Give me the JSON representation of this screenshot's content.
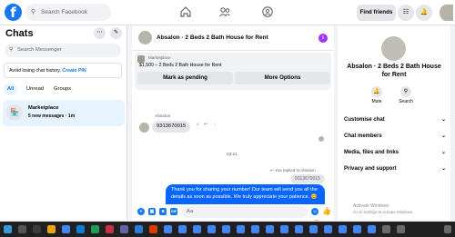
{
  "topbar": {
    "logo": "f",
    "search_placeholder": "Search Facebook",
    "find_friends": "Find friends"
  },
  "sidebar": {
    "title": "Chats",
    "search_placeholder": "Search Messenger",
    "pin_notice": "Avoid losing chat history.",
    "pin_link": "Create PIN",
    "filters": [
      "All",
      "Unread",
      "Groups"
    ],
    "chat": {
      "name": "Marketplace",
      "preview": "5 new messages · 1m"
    }
  },
  "conversation": {
    "title": "Absalon · 2 Beds 2 Bath House for Rent",
    "listing": {
      "label": "Marketplace",
      "price_line": "$1,500 – 2 Beds 2 Bath House for Rent",
      "mark_pending": "Mark as pending",
      "more_options": "More Options"
    },
    "messages": {
      "sender_name": "Absalon",
      "incoming_text": "9313670015",
      "timestamp": "03:21",
      "reply_indicator": "You replied to Absalon",
      "reply_quote": "9313670015",
      "outgoing_text": "Thank you for sharing your number! Our team will send you all the details as soon as possible. We truly appreciate your patience. 😊"
    },
    "composer_placeholder": "Aa"
  },
  "details_panel": {
    "title": "Absalon · 2 Beds 2 Bath House for Rent",
    "actions": [
      {
        "label": "Mute",
        "icon": "bell-icon"
      },
      {
        "label": "Search",
        "icon": "search-icon"
      }
    ],
    "sections": [
      "Customise chat",
      "Chat members",
      "Media, files and links",
      "Privacy and support"
    ]
  },
  "watermark": {
    "title": "Activate Windows",
    "subtitle": "Go to Settings to activate Windows."
  },
  "colors": {
    "brand_blue": "#1877f2",
    "message_blue": "#0866ff",
    "info_purple": "#a033ff",
    "taskbar": "#202020"
  }
}
